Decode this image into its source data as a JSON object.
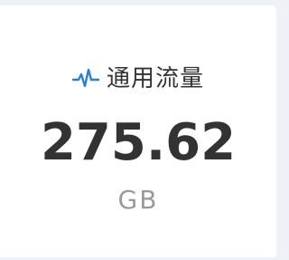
{
  "card": {
    "icon": "pulse-icon",
    "title": "通用流量",
    "value": "275.62",
    "unit": "GB"
  },
  "colors": {
    "icon": "#2a7fd4",
    "text": "#333333",
    "unit": "#9a9a9a",
    "background": "#eef2f7",
    "card": "#ffffff"
  }
}
